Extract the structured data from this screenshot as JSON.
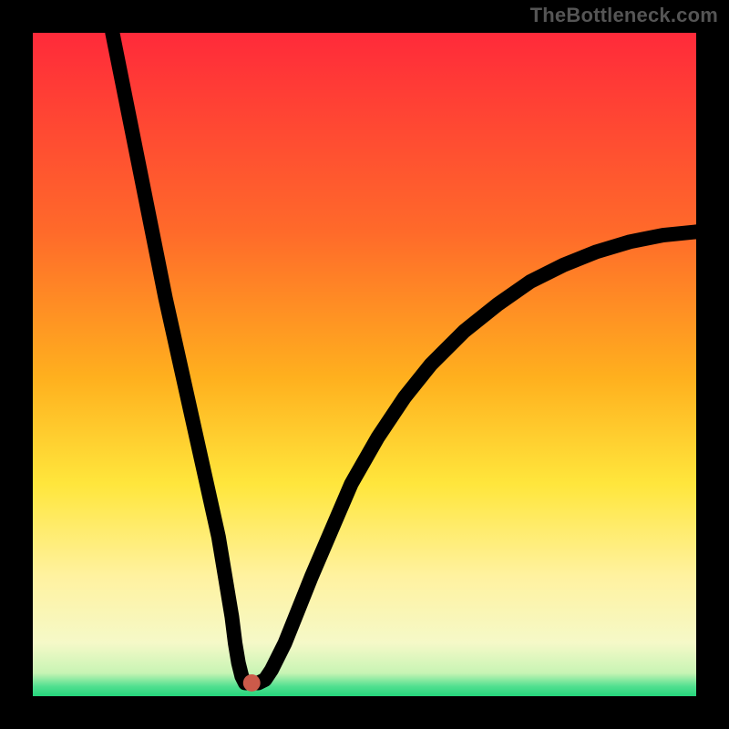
{
  "watermark": "TheBottleneck.com",
  "chart_data": {
    "type": "line",
    "title": "",
    "xlabel": "",
    "ylabel": "",
    "xlim": [
      0,
      100
    ],
    "ylim": [
      0,
      100
    ],
    "grid": false,
    "gradient_stops": [
      {
        "offset": 0.0,
        "color": "#ff2a3a"
      },
      {
        "offset": 0.3,
        "color": "#ff6a2a"
      },
      {
        "offset": 0.52,
        "color": "#ffb01e"
      },
      {
        "offset": 0.68,
        "color": "#ffe63c"
      },
      {
        "offset": 0.82,
        "color": "#fff2a0"
      },
      {
        "offset": 0.92,
        "color": "#f5f9c8"
      },
      {
        "offset": 0.965,
        "color": "#c8f4b4"
      },
      {
        "offset": 0.985,
        "color": "#52e o"
      },
      {
        "offset": 1.0,
        "color": "#25d47b"
      }
    ],
    "series": [
      {
        "name": "bottleneck-curve",
        "x": [
          12,
          14,
          16,
          18,
          20,
          22,
          24,
          26,
          28,
          29,
          30,
          30.5,
          31,
          31.5,
          32,
          33,
          34,
          35,
          36,
          38,
          40,
          42,
          45,
          48,
          52,
          56,
          60,
          65,
          70,
          75,
          80,
          85,
          90,
          95,
          100
        ],
        "y": [
          100,
          90,
          80,
          70,
          60,
          51,
          42,
          33,
          24,
          18,
          12,
          8,
          5,
          3,
          2,
          2,
          2,
          2.5,
          4,
          8,
          13,
          18,
          25,
          32,
          39,
          45,
          50,
          55,
          59,
          62.5,
          65,
          67,
          68.5,
          69.5,
          70
        ]
      }
    ],
    "marker": {
      "x": 33,
      "y": 2,
      "r": 1.3
    },
    "annotations": []
  }
}
